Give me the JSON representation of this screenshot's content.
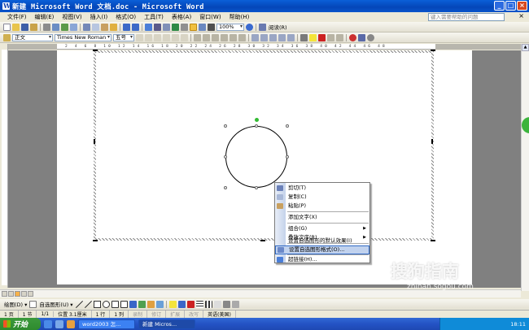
{
  "window": {
    "title": "新建 Microsoft Word 文档.doc - Microsoft Word"
  },
  "menu": {
    "items": [
      "文件(F)",
      "编辑(E)",
      "视图(V)",
      "插入(I)",
      "格式(O)",
      "工具(T)",
      "表格(A)",
      "窗口(W)",
      "帮助(H)"
    ],
    "help_placeholder": "键入需要帮助的问题",
    "close_doc": "×"
  },
  "toolbar": {
    "zoom": "100%",
    "read_label": "阅读(R)",
    "style": "正文",
    "font": "Times New Roman",
    "size": "五号"
  },
  "ruler": {
    "numbers": "2 4 6 8 10 12 14 16 18 20 22 24 26 28 30 32 34 36 38 40 42 44 46 48"
  },
  "context_menu": {
    "items": [
      {
        "label": "剪切(T)"
      },
      {
        "label": "复制(C)"
      },
      {
        "label": "粘贴(P)"
      },
      {
        "label": "添加文字(X)"
      },
      {
        "label": "组合(G)",
        "submenu": true
      },
      {
        "label": "叠放次序(R)",
        "submenu": true
      },
      {
        "label": "设置自选图形的默认效果(I)"
      },
      {
        "label": "设置自选图形格式(O)...",
        "highlighted": true
      },
      {
        "label": "超链接(H)..."
      }
    ]
  },
  "drawing_toolbar": {
    "draw_label": "绘图(D) ▾",
    "autoshapes_label": "自选图形(U) ▾"
  },
  "status": {
    "page": "1 页",
    "section": "1 节",
    "page_of": "1/1",
    "position": "位置 3.1厘米",
    "line": "1 行",
    "col": "1 列",
    "rec": "录制",
    "trk": "修订",
    "ext": "扩展",
    "ovr": "改写",
    "language": "英语(美国)"
  },
  "taskbar": {
    "start": "开始",
    "tasks": [
      "word2003 怎...",
      "新建 Micros..."
    ],
    "clock": "18:11"
  },
  "watermark": {
    "text": "搜狗指南",
    "url": "zhinan.sogou.com"
  }
}
